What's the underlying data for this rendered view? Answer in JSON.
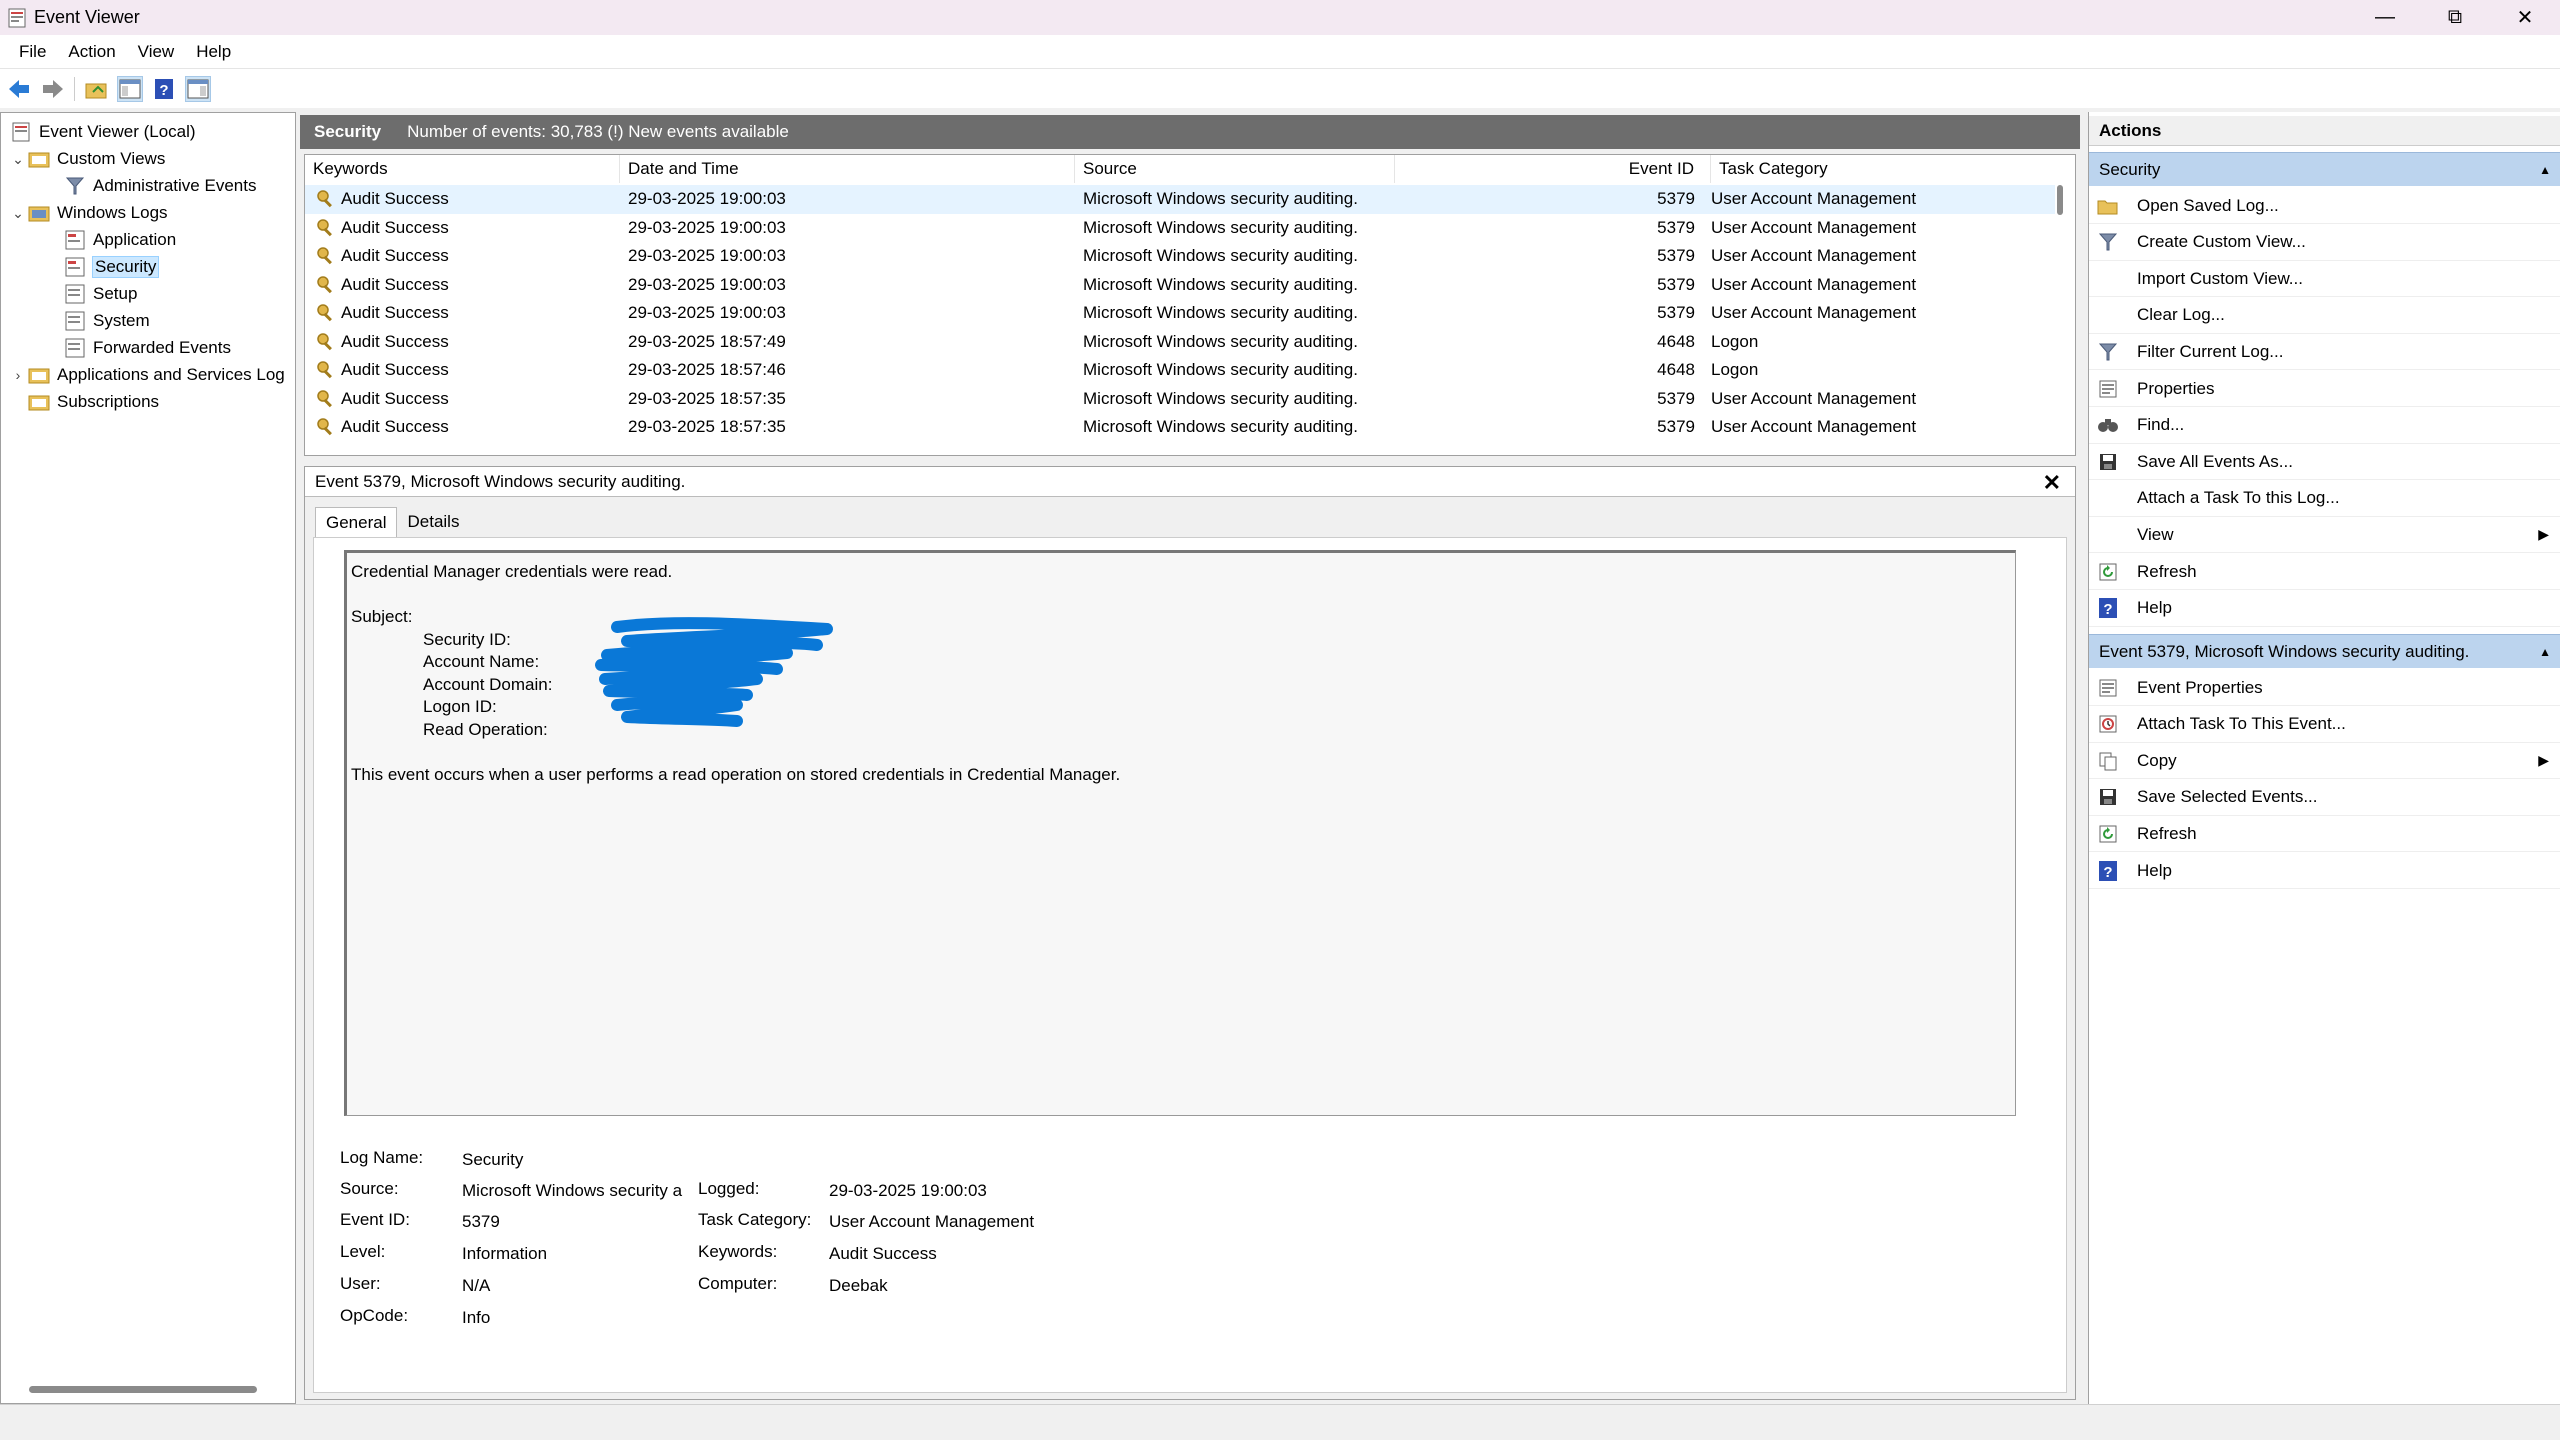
{
  "window": {
    "title": "Event Viewer"
  },
  "menu": [
    "File",
    "Action",
    "View",
    "Help"
  ],
  "tree": {
    "root": "Event Viewer (Local)",
    "custom_views": "Custom Views",
    "administrative_events": "Administrative Events",
    "windows_logs": "Windows Logs",
    "application": "Application",
    "security": "Security",
    "setup": "Setup",
    "system": "System",
    "forwarded_events": "Forwarded Events",
    "apps_services": "Applications and Services Log",
    "subscriptions": "Subscriptions"
  },
  "log_header": {
    "name": "Security",
    "info": "Number of events: 30,783 (!) New events available"
  },
  "columns": {
    "keywords": "Keywords",
    "date_time": "Date and Time",
    "source": "Source",
    "event_id": "Event ID",
    "task_category": "Task Category"
  },
  "rows": [
    {
      "keywords": "Audit Success",
      "date": "29-03-2025 19:00:03",
      "source": "Microsoft Windows security auditing.",
      "id": "5379",
      "category": "User Account Management"
    },
    {
      "keywords": "Audit Success",
      "date": "29-03-2025 19:00:03",
      "source": "Microsoft Windows security auditing.",
      "id": "5379",
      "category": "User Account Management"
    },
    {
      "keywords": "Audit Success",
      "date": "29-03-2025 19:00:03",
      "source": "Microsoft Windows security auditing.",
      "id": "5379",
      "category": "User Account Management"
    },
    {
      "keywords": "Audit Success",
      "date": "29-03-2025 19:00:03",
      "source": "Microsoft Windows security auditing.",
      "id": "5379",
      "category": "User Account Management"
    },
    {
      "keywords": "Audit Success",
      "date": "29-03-2025 19:00:03",
      "source": "Microsoft Windows security auditing.",
      "id": "5379",
      "category": "User Account Management"
    },
    {
      "keywords": "Audit Success",
      "date": "29-03-2025 18:57:49",
      "source": "Microsoft Windows security auditing.",
      "id": "4648",
      "category": "Logon"
    },
    {
      "keywords": "Audit Success",
      "date": "29-03-2025 18:57:46",
      "source": "Microsoft Windows security auditing.",
      "id": "4648",
      "category": "Logon"
    },
    {
      "keywords": "Audit Success",
      "date": "29-03-2025 18:57:35",
      "source": "Microsoft Windows security auditing.",
      "id": "5379",
      "category": "User Account Management"
    },
    {
      "keywords": "Audit Success",
      "date": "29-03-2025 18:57:35",
      "source": "Microsoft Windows security auditing.",
      "id": "5379",
      "category": "User Account Management"
    }
  ],
  "detail": {
    "title": "Event 5379, Microsoft Windows security auditing.",
    "tab_general": "General",
    "tab_details": "Details",
    "message_line1": "Credential Manager credentials were read.",
    "subject": "Subject:",
    "field_security_id": "Security ID:",
    "field_account_name": "Account Name:",
    "field_account_domain": "Account Domain:",
    "field_logon_id": "Logon ID:",
    "field_read_operation": "Read Operation:",
    "message_footer": "This event occurs when a user performs a read operation on stored credentials in Credential Manager.",
    "props": {
      "log_name_label": "Log Name:",
      "log_name": "Security",
      "source_label": "Source:",
      "source": "Microsoft Windows security a",
      "logged_label": "Logged:",
      "logged": "29-03-2025 19:00:03",
      "event_id_label": "Event ID:",
      "event_id": "5379",
      "task_category_label": "Task Category:",
      "task_category": "User Account Management",
      "level_label": "Level:",
      "level": "Information",
      "keywords_label": "Keywords:",
      "keywords": "Audit Success",
      "user_label": "User:",
      "user": "N/A",
      "computer_label": "Computer:",
      "computer": "Deebak",
      "opcode_label": "OpCode:",
      "opcode": "Info"
    }
  },
  "actions": {
    "title": "Actions",
    "section1": "Security",
    "items1": [
      {
        "label": "Open Saved Log...",
        "icon": "folder-open-icon"
      },
      {
        "label": "Create Custom View...",
        "icon": "filter-icon"
      },
      {
        "label": "Import Custom View...",
        "icon": ""
      },
      {
        "label": "Clear Log...",
        "icon": ""
      },
      {
        "label": "Filter Current Log...",
        "icon": "filter-icon"
      },
      {
        "label": "Properties",
        "icon": "properties-icon"
      },
      {
        "label": "Find...",
        "icon": "binoculars-icon"
      },
      {
        "label": "Save All Events As...",
        "icon": "save-icon"
      },
      {
        "label": "Attach a Task To this Log...",
        "icon": ""
      },
      {
        "label": "View",
        "icon": "",
        "submenu": true
      },
      {
        "label": "Refresh",
        "icon": "refresh-icon"
      },
      {
        "label": "Help",
        "icon": "help-icon"
      }
    ],
    "section2": "Event 5379, Microsoft Windows security auditing.",
    "items2": [
      {
        "label": "Event Properties",
        "icon": "properties-icon"
      },
      {
        "label": "Attach Task To This Event...",
        "icon": "task-icon"
      },
      {
        "label": "Copy",
        "icon": "copy-icon",
        "submenu": true
      },
      {
        "label": "Save Selected Events...",
        "icon": "save-icon"
      },
      {
        "label": "Refresh",
        "icon": "refresh-icon"
      },
      {
        "label": "Help",
        "icon": "help-icon"
      }
    ]
  },
  "colors": {
    "section_header": "#bcd4ee",
    "log_header": "#6d6d6d",
    "redaction": "#0a78d7"
  }
}
